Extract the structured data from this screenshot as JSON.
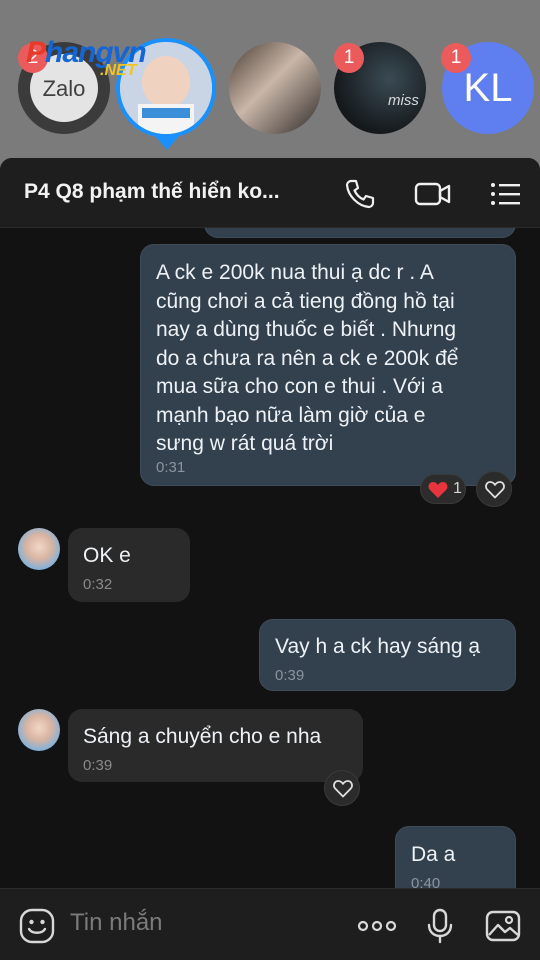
{
  "chat_heads": {
    "watermark_main": "Phangvn",
    "watermark_letter": "P",
    "watermark_sub": ".NET",
    "zalo": {
      "label": "Zalo",
      "badge": "2"
    },
    "photo3": {
      "badge": "1"
    },
    "kl": {
      "initials": "KL",
      "badge": "1"
    }
  },
  "header": {
    "title": "P4 Q8 phạm thế hiển ko...",
    "call_icon": "phone-icon",
    "video_icon": "video-camera-icon",
    "menu_icon": "menu-list-icon"
  },
  "messages": [
    {
      "type": "sent",
      "lines": [
        "A ck e 200k nua thui ạ dc r . A",
        "cũng chơi a cả tieng đồng hồ tại",
        "nay a dùng thuốc e biết . Nhưng",
        "do a chưa ra nên a ck e 200k để",
        "mua sữa cho con e thui .  Với a",
        "mạnh bạo nữa làm giờ của e",
        "sưng w rát quá trời"
      ],
      "time": "0:31",
      "reaction": {
        "icon": "heart-filled-icon",
        "count": "1"
      }
    },
    {
      "type": "recv",
      "text": "OK e",
      "time": "0:32"
    },
    {
      "type": "sent",
      "text": "Vay h a ck hay sáng ạ",
      "time": "0:39"
    },
    {
      "type": "recv",
      "text": "Sáng a chuyển cho e nha",
      "time": "0:39"
    },
    {
      "type": "sent",
      "text": "Da a",
      "time": "0:40"
    }
  ],
  "composer": {
    "placeholder": "Tin nhắn",
    "sticker_icon": "sticker-smile-icon",
    "more_icon": "more-dots-icon",
    "mic_icon": "microphone-icon",
    "image_icon": "image-icon"
  },
  "colors": {
    "accent": "#1a8fff",
    "badge": "#ec5b5b",
    "sent_bubble": "#33404d",
    "recv_bubble": "#2a2a2a",
    "background": "#121212"
  }
}
